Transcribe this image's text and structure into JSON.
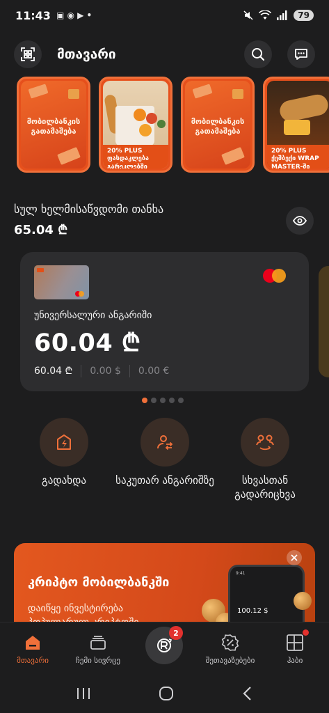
{
  "status_bar": {
    "time": "11:43",
    "mini_icons": "▣ ◉ ▶ •",
    "battery": "79"
  },
  "header": {
    "title": "მთავარი"
  },
  "stories": [
    {
      "kind": "promo",
      "text": "მობილბანკის გათამაშება"
    },
    {
      "kind": "photo",
      "caption": "20% PLUS ფასდაკლება გარეკლებში"
    },
    {
      "kind": "promo",
      "text": "მობილბანკის გათამაშება"
    },
    {
      "kind": "food",
      "caption": "20% PLUS ქეშბექი WRAP MASTER-ში"
    }
  ],
  "balance": {
    "label": "სულ ხელმისაწვდომი თანხა",
    "value": "65.04 ₾"
  },
  "account": {
    "name": "უნივერსალური ანგარიში",
    "balance": "60.04 ₾",
    "gel": "60.04 ₾",
    "usd": "0.00 $",
    "eur": "0.00 €"
  },
  "pager": {
    "count": 5,
    "active": 0
  },
  "actions": [
    {
      "label": "გადახდა",
      "icon": "payment-icon"
    },
    {
      "label": "საკუთარ ანგარიშზე",
      "icon": "own-transfer-icon"
    },
    {
      "label": "სხვასთან გადარიცხვა",
      "icon": "transfer-to-others-icon"
    }
  ],
  "promo": {
    "title": "კრიპტო მობილბანკში",
    "subtitle_line1": "დაიწყე ინვესტირება",
    "subtitle_line2": "პოპულარულ კრიპტოში",
    "phone_amount": "100.12 $",
    "phone_time": "9:41"
  },
  "bottom_nav": {
    "items": [
      {
        "label": "მთავარი",
        "icon": "home-icon",
        "active": true
      },
      {
        "label": "ჩემი სივრცე",
        "icon": "wallet-icon",
        "active": false
      },
      {
        "label": "შეთავაზებები",
        "icon": "discount-icon",
        "active": false
      },
      {
        "label": "ჰაბი",
        "icon": "hub-icon",
        "active": false
      }
    ],
    "center_badge": "2"
  },
  "colors": {
    "accent": "#f0703a",
    "background": "#1d1d1e",
    "card": "#2d2d2f",
    "badge": "#e2312e"
  }
}
